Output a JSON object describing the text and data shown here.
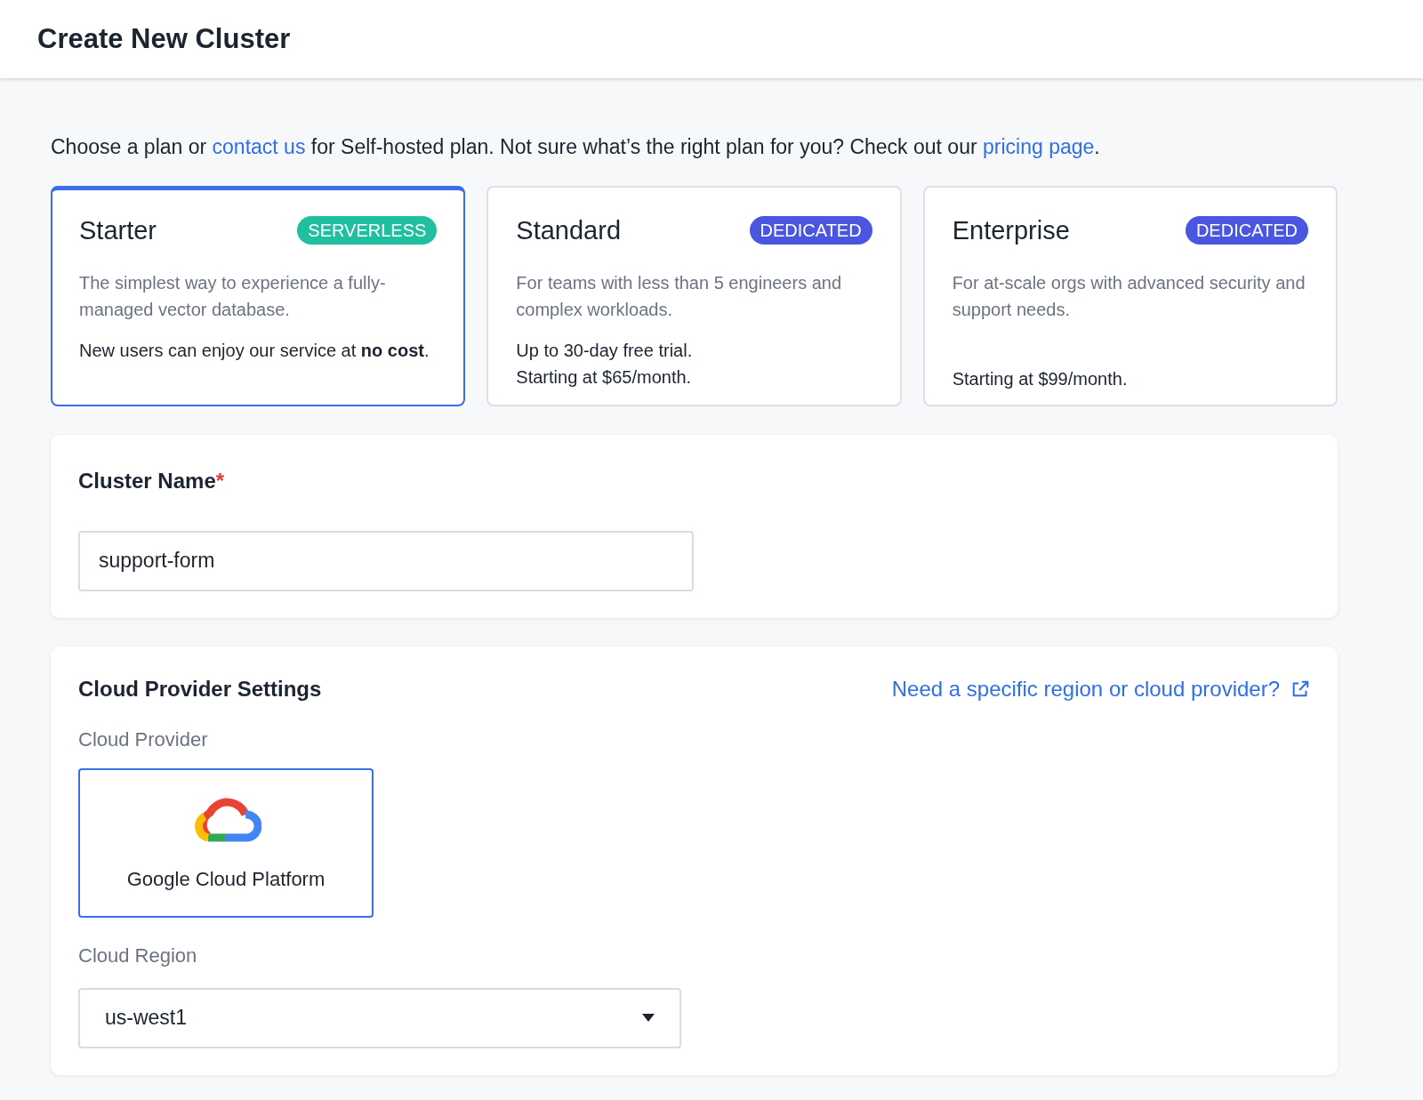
{
  "page": {
    "title": "Create New Cluster"
  },
  "intro": {
    "before": "Choose a plan or ",
    "link1": "contact us",
    "middle": " for Self-hosted plan. Not sure what’s the right plan for you? Check out our ",
    "link2": "pricing page",
    "after": "."
  },
  "plans": [
    {
      "name": "Starter",
      "badge": "SERVERLESS",
      "color": "#1fbf9f",
      "selected": true,
      "description": "The simplest way to experience a fully-managed vector database.",
      "details": [
        "New users can enjoy our service at **no cost**."
      ]
    },
    {
      "name": "Standard",
      "badge": "DEDICATED",
      "color": "#4a55e0",
      "selected": false,
      "description": "For teams with less than 5 engineers and complex workloads.",
      "details": [
        "Up to 30-day free trial.",
        "Starting at $65/month."
      ]
    },
    {
      "name": "Enterprise",
      "badge": "DEDICATED",
      "color": "#4a55e0",
      "selected": false,
      "description": "For at-scale orgs with advanced security and support needs.",
      "details": [
        "Starting at $99/month."
      ]
    }
  ],
  "cluster_name": {
    "label": "Cluster Name",
    "required_mark": "*",
    "value": "support-form"
  },
  "cloud_settings": {
    "title": "Cloud Provider Settings",
    "help_link": "Need a specific region or cloud provider?",
    "provider_label": "Cloud Provider",
    "providers": [
      {
        "name": "Google Cloud Platform",
        "selected": true
      }
    ],
    "region_label": "Cloud Region",
    "region_value": "us-west1"
  }
}
